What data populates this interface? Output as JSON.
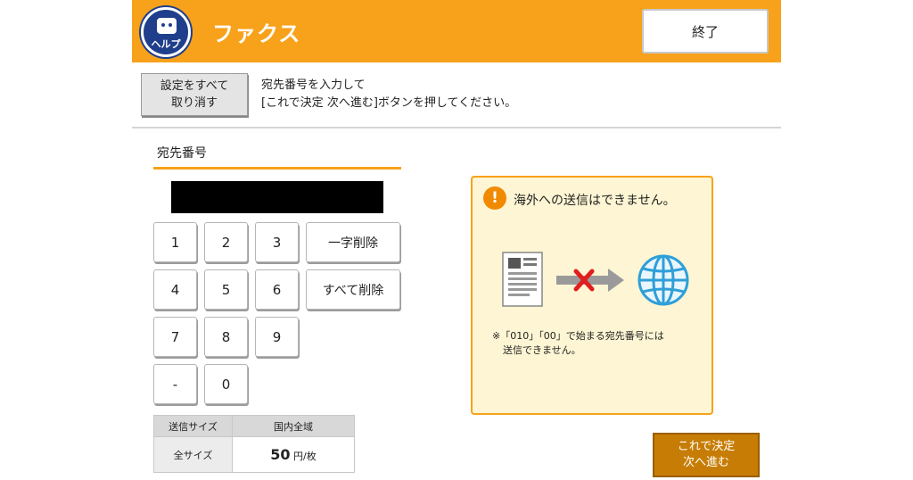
{
  "header": {
    "help_label": "ヘルプ",
    "title": "ファクス",
    "end_label": "終了"
  },
  "toolbar": {
    "reset_line1": "設定をすべて",
    "reset_line2": "取り消す",
    "instruction_line1": "宛先番号を入力して",
    "instruction_line2": "[これで決定 次へ進む]ボタンを押してください。"
  },
  "destination": {
    "label": "宛先番号",
    "value": ""
  },
  "keypad": {
    "k1": "1",
    "k2": "2",
    "k3": "3",
    "k4": "4",
    "k5": "5",
    "k6": "6",
    "k7": "7",
    "k8": "8",
    "k9": "9",
    "dash": "-",
    "k0": "0",
    "delete_one": "一字削除",
    "delete_all": "すべて削除"
  },
  "size_table": {
    "col1_header": "送信サイズ",
    "col2_header": "国内全域",
    "row_label": "全サイズ",
    "price": "50",
    "unit": "円/枚"
  },
  "notice": {
    "icon": "exclamation-icon",
    "warning": "海外への送信はできません。",
    "note_line1": "※「010」「00」で始まる宛先番号には",
    "note_line2": "送信できません。"
  },
  "confirm": {
    "line1": "これで決定",
    "line2": "次へ進む"
  },
  "colors": {
    "accent": "#f7a21a",
    "help_blue": "#1f3f8c",
    "confirm": "#c77d05",
    "notice_bg": "#fdf5d3"
  }
}
